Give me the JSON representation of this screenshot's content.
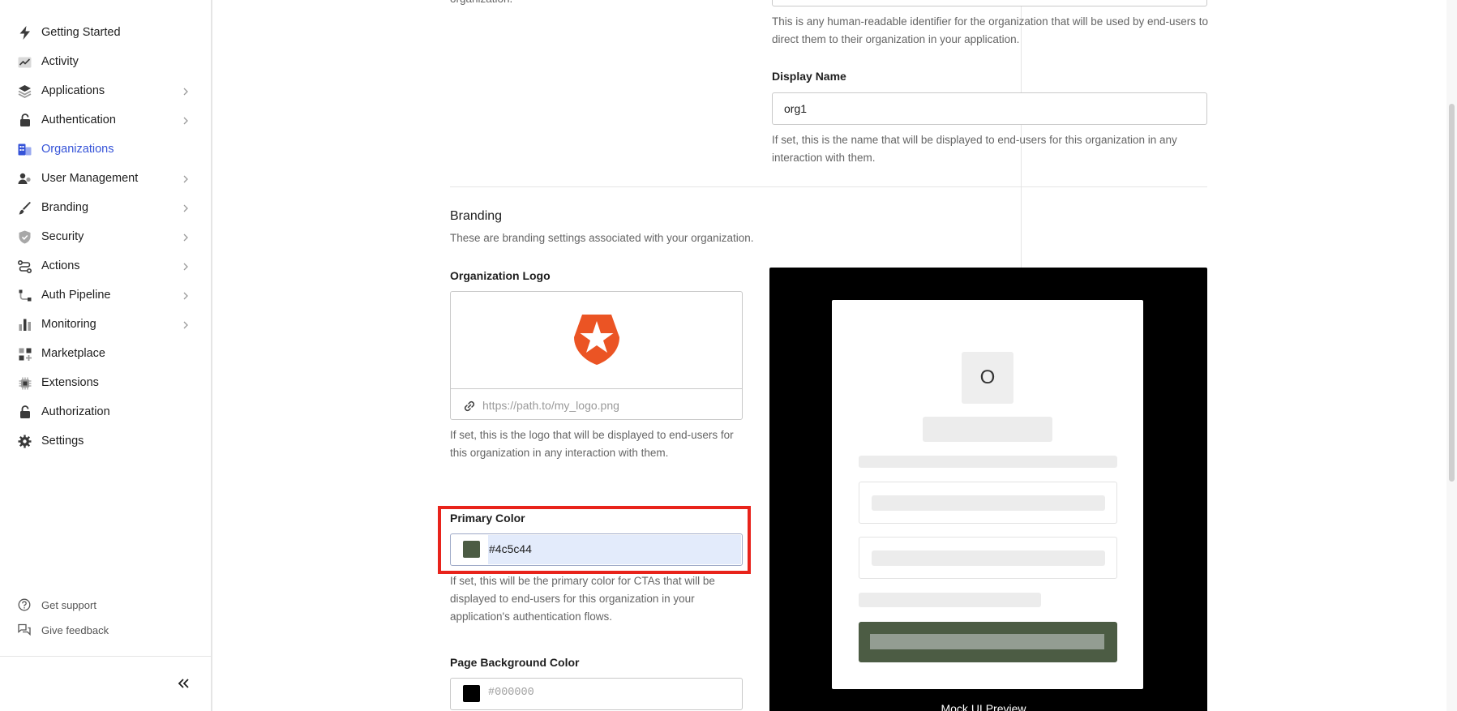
{
  "sidebar": {
    "items": [
      {
        "label": "Getting Started",
        "icon": "bolt-icon",
        "chevron": false,
        "active": false
      },
      {
        "label": "Activity",
        "icon": "activity-chart-icon",
        "chevron": false,
        "active": false
      },
      {
        "label": "Applications",
        "icon": "layers-icon",
        "chevron": true,
        "active": false
      },
      {
        "label": "Authentication",
        "icon": "lock-icon",
        "chevron": true,
        "active": false
      },
      {
        "label": "Organizations",
        "icon": "building-icon",
        "chevron": false,
        "active": true
      },
      {
        "label": "User Management",
        "icon": "users-icon",
        "chevron": true,
        "active": false
      },
      {
        "label": "Branding",
        "icon": "brush-icon",
        "chevron": true,
        "active": false
      },
      {
        "label": "Security",
        "icon": "shield-icon",
        "chevron": true,
        "active": false
      },
      {
        "label": "Actions",
        "icon": "flow-icon",
        "chevron": true,
        "active": false
      },
      {
        "label": "Auth Pipeline",
        "icon": "pipeline-icon",
        "chevron": true,
        "active": false
      },
      {
        "label": "Monitoring",
        "icon": "bar-chart-icon",
        "chevron": true,
        "active": false
      },
      {
        "label": "Marketplace",
        "icon": "grid-plus-icon",
        "chevron": false,
        "active": false
      },
      {
        "label": "Extensions",
        "icon": "chip-icon",
        "chevron": false,
        "active": false
      },
      {
        "label": "Authorization",
        "icon": "lock-icon",
        "chevron": false,
        "active": false
      },
      {
        "label": "Settings",
        "icon": "gear-icon",
        "chevron": false,
        "active": false
      }
    ],
    "footer": {
      "support_label": "Get support",
      "feedback_label": "Give feedback"
    },
    "accent_color": "#3553d8"
  },
  "form": {
    "name_partial_label": "organization.",
    "name_help": "This is any human-readable identifier for the organization that will be used by end-users to direct them to their organization in your application.",
    "display_name": {
      "label": "Display Name",
      "value": "org1",
      "help": "If set, this is the name that will be displayed to end-users for this organization in any interaction with them."
    },
    "branding": {
      "title": "Branding",
      "subtitle": "These are branding settings associated with your organization.",
      "logo": {
        "label": "Organization Logo",
        "placeholder": "https://path.to/my_logo.png",
        "help": "If set, this is the logo that will be displayed to end-users for this organization in any interaction with them."
      },
      "primary_color": {
        "label": "Primary Color",
        "value": "#4c5c44",
        "help": "If set, this will be the primary color for CTAs that will be displayed to end-users for this organization in your application's authentication flows."
      },
      "page_background_color": {
        "label": "Page Background Color",
        "placeholder": "#000000",
        "swatch": "#000000"
      }
    }
  },
  "preview": {
    "avatar_letter": "O",
    "caption": "Mock UI Preview",
    "button_color": "#4c5c44",
    "background": "#000000"
  }
}
